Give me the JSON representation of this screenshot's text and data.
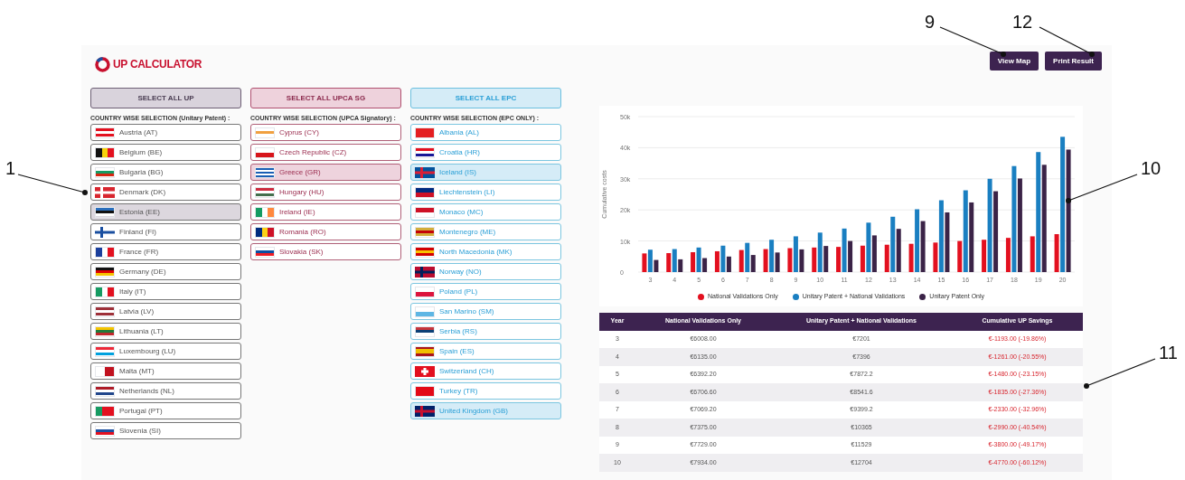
{
  "header": {
    "logo_text": "UP CALCULATOR",
    "buttons": [
      "View Map",
      "Print Result"
    ]
  },
  "groups": [
    {
      "kind": "up",
      "button": "SELECT ALL UP",
      "heading": "COUNTRY WISE SELECTION (Unitary Patent) :",
      "countries": [
        {
          "name": "Austria (AT)",
          "selected": false
        },
        {
          "name": "Belgium (BE)",
          "selected": false
        },
        {
          "name": "Bulgaria (BG)",
          "selected": false
        },
        {
          "name": "Denmark (DK)",
          "selected": false
        },
        {
          "name": "Estonia (EE)",
          "selected": true
        },
        {
          "name": "Finland (FI)",
          "selected": false
        },
        {
          "name": "France (FR)",
          "selected": false
        },
        {
          "name": "Germany (DE)",
          "selected": false
        },
        {
          "name": "Italy (IT)",
          "selected": false
        },
        {
          "name": "Latvia (LV)",
          "selected": false
        },
        {
          "name": "Lithuania (LT)",
          "selected": false
        },
        {
          "name": "Luxembourg (LU)",
          "selected": false
        },
        {
          "name": "Malta (MT)",
          "selected": false
        },
        {
          "name": "Netherlands (NL)",
          "selected": false
        },
        {
          "name": "Portugal (PT)",
          "selected": false
        },
        {
          "name": "Slovenia (SI)",
          "selected": false
        }
      ]
    },
    {
      "kind": "upca",
      "button": "SELECT ALL UPCA SG",
      "heading": "COUNTRY WISE SELECTION (UPCA Signatory) :",
      "countries": [
        {
          "name": "Cyprus (CY)",
          "selected": false
        },
        {
          "name": "Czech Republic (CZ)",
          "selected": false
        },
        {
          "name": "Greece (GR)",
          "selected": true
        },
        {
          "name": "Hungary (HU)",
          "selected": false
        },
        {
          "name": "Ireland (IE)",
          "selected": false
        },
        {
          "name": "Romania (RO)",
          "selected": false
        },
        {
          "name": "Slovakia (SK)",
          "selected": false
        }
      ]
    },
    {
      "kind": "epc",
      "button": "SELECT ALL EPC",
      "heading": "COUNTRY WISE SELECTION (EPC ONLY) :",
      "countries": [
        {
          "name": "Albania (AL)",
          "selected": false
        },
        {
          "name": "Croatia (HR)",
          "selected": false
        },
        {
          "name": "Iceland (IS)",
          "selected": true
        },
        {
          "name": "Liechtenstein (LI)",
          "selected": false
        },
        {
          "name": "Monaco (MC)",
          "selected": false
        },
        {
          "name": "Montenegro (ME)",
          "selected": false
        },
        {
          "name": "North Macedonia (MK)",
          "selected": false
        },
        {
          "name": "Norway (NO)",
          "selected": false
        },
        {
          "name": "Poland (PL)",
          "selected": false
        },
        {
          "name": "San Marino (SM)",
          "selected": false
        },
        {
          "name": "Serbia (RS)",
          "selected": false
        },
        {
          "name": "Spain (ES)",
          "selected": false
        },
        {
          "name": "Switzerland (CH)",
          "selected": false
        },
        {
          "name": "Turkey (TR)",
          "selected": false
        },
        {
          "name": "United Kingdom (GB)",
          "selected": true
        }
      ]
    }
  ],
  "chart": {
    "chart_data": {
      "type": "bar",
      "ylabel": "Cumulative costs",
      "categories": [
        "3",
        "4",
        "5",
        "6",
        "7",
        "8",
        "9",
        "10",
        "11",
        "12",
        "13",
        "14",
        "15",
        "16",
        "17",
        "18",
        "19",
        "20"
      ],
      "series": [
        {
          "name": "National Validations Only",
          "color": "#e3101f",
          "values": [
            6000,
            6100,
            6400,
            6700,
            7100,
            7400,
            7700,
            7900,
            8100,
            8500,
            8800,
            9100,
            9500,
            10000,
            10400,
            11000,
            11500,
            12200
          ]
        },
        {
          "name": "Unitary Patent + National Validations",
          "color": "#1a7fc1",
          "values": [
            7200,
            7400,
            7900,
            8500,
            9400,
            10400,
            11500,
            12700,
            14000,
            15900,
            17800,
            20200,
            23100,
            26300,
            30000,
            34100,
            38600,
            43500
          ]
        },
        {
          "name": "Unitary Patent Only",
          "color": "#3b2347",
          "values": [
            3900,
            4100,
            4500,
            5000,
            5500,
            6300,
            7300,
            8400,
            10000,
            11800,
            13900,
            16400,
            19200,
            22400,
            26000,
            30100,
            34500,
            39400
          ]
        }
      ],
      "grid": true,
      "ylim": [
        0,
        50000
      ],
      "yticks": [
        {
          "value": 0,
          "label": "0"
        },
        {
          "value": 10000,
          "label": "10k"
        },
        {
          "value": 20000,
          "label": "20k"
        },
        {
          "value": 30000,
          "label": "30k"
        },
        {
          "value": 40000,
          "label": "40k"
        },
        {
          "value": 50000,
          "label": "50k"
        }
      ]
    }
  },
  "table": {
    "columns": [
      "Year",
      "National Validations Only",
      "Unitary Patent + National Validations",
      "Cumulative UP Savings"
    ],
    "rows": [
      [
        "3",
        "€6008.00",
        "€7201",
        "€-1193.00 (-19.86%)"
      ],
      [
        "4",
        "€6135.00",
        "€7396",
        "€-1261.00 (-20.55%)"
      ],
      [
        "5",
        "€6392.20",
        "€7872.2",
        "€-1480.00 (-23.15%)"
      ],
      [
        "6",
        "€6706.60",
        "€8541.6",
        "€-1835.00 (-27.36%)"
      ],
      [
        "7",
        "€7069.20",
        "€9399.2",
        "€-2330.00 (-32.96%)"
      ],
      [
        "8",
        "€7375.00",
        "€10365",
        "€-2990.00 (-40.54%)"
      ],
      [
        "9",
        "€7729.00",
        "€11529",
        "€-3800.00 (-49.17%)"
      ],
      [
        "10",
        "€7934.00",
        "€12704",
        "€-4770.00 (-60.12%)"
      ]
    ]
  },
  "callouts": [
    "1",
    "9",
    "12",
    "10",
    "11"
  ]
}
